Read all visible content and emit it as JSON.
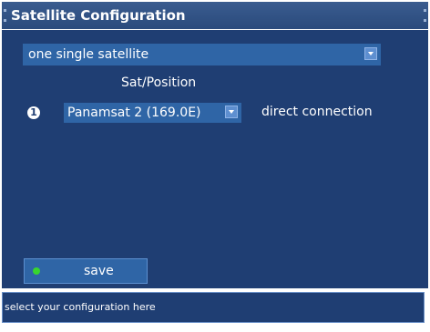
{
  "window": {
    "title": "Satellite Configuration"
  },
  "config": {
    "selected": "one single satellite",
    "icon": "chevron-down-icon"
  },
  "table": {
    "header": "Sat/Position"
  },
  "satellite": {
    "index": "1",
    "position": "Panamsat 2 (169.0E)",
    "connection": "direct connection"
  },
  "save": {
    "label": "save",
    "indicator_color": "#38d62e"
  },
  "status": {
    "text": "select your configuration here"
  },
  "colors": {
    "panel": "#1f3e73",
    "titlebar": "#2a4a7c",
    "dropdown": "#2f65a6",
    "text": "#ffffff"
  }
}
